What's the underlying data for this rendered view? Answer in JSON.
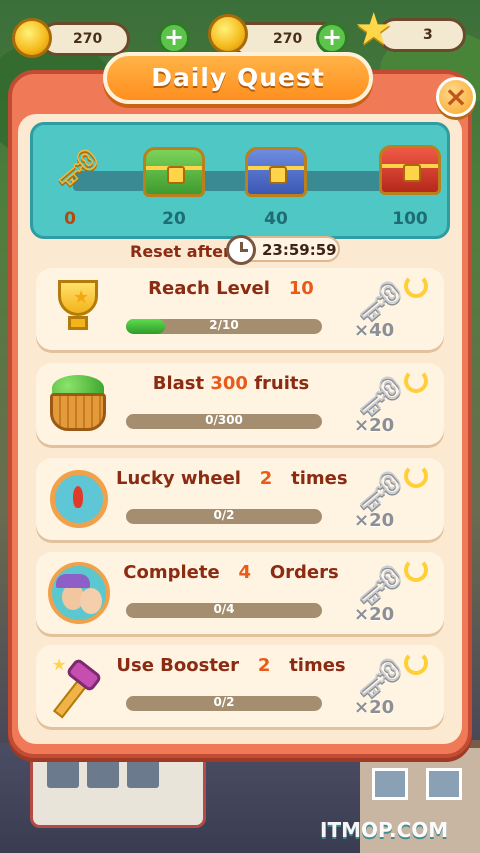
{
  "topbar": {
    "coins": "270",
    "coins2": "270",
    "stars": "3",
    "plus": "+"
  },
  "panel": {
    "title": "Daily  Quest",
    "close": "×"
  },
  "rewards": {
    "milestones": [
      "0",
      "20",
      "40",
      "100"
    ],
    "reset_label": "Reset after",
    "timer": "23:59:59"
  },
  "quests": [
    {
      "pre": "Reach Level",
      "num": "10",
      "post": "",
      "progress": "2/10",
      "fraction": 0.2,
      "reward": "×40"
    },
    {
      "pre": "Blast ",
      "num": "300",
      "post": " fruits",
      "progress": "0/300",
      "fraction": 0,
      "reward": "×20"
    },
    {
      "pre": "Lucky wheel",
      "num": "2",
      "post": "times",
      "progress": "0/2",
      "fraction": 0,
      "reward": "×20"
    },
    {
      "pre": "Complete",
      "num": "4",
      "post": "Orders",
      "progress": "0/4",
      "fraction": 0,
      "reward": "×20"
    },
    {
      "pre": "Use Booster",
      "num": "2",
      "post": "times",
      "progress": "0/2",
      "fraction": 0,
      "reward": "×20"
    }
  ],
  "watermark": "ITMOP.COM",
  "colors": {
    "panel": "#f07a58",
    "band": "#4fc7c5",
    "title": "#ff8f1f",
    "progress": "#4cc43f"
  }
}
